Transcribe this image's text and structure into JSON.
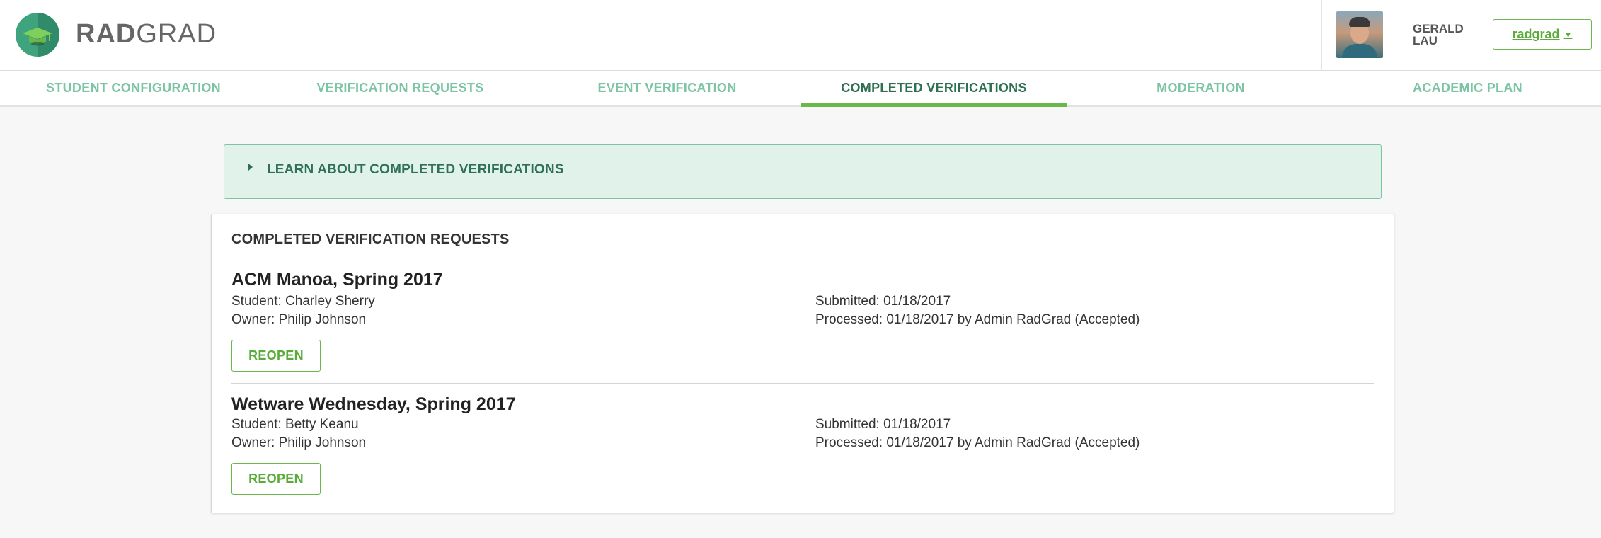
{
  "header": {
    "logo_bold": "RAD",
    "logo_rest": "GRAD",
    "user_name": "GERALD LAU",
    "account_label": "radgrad"
  },
  "tabs": [
    {
      "label": "STUDENT CONFIGURATION",
      "active": false
    },
    {
      "label": "VERIFICATION REQUESTS",
      "active": false
    },
    {
      "label": "EVENT VERIFICATION",
      "active": false
    },
    {
      "label": "COMPLETED VERIFICATIONS",
      "active": true
    },
    {
      "label": "MODERATION",
      "active": false
    },
    {
      "label": "ACADEMIC PLAN",
      "active": false
    }
  ],
  "info": {
    "label": "LEARN ABOUT COMPLETED VERIFICATIONS"
  },
  "completed": {
    "title": "COMPLETED VERIFICATION REQUESTS",
    "reopen_label": "REOPEN",
    "requests": [
      {
        "title": "ACM Manoa, Spring 2017",
        "student": "Student: Charley Sherry",
        "owner": "Owner: Philip Johnson",
        "submitted": "Submitted: 01/18/2017",
        "processed": "Processed: 01/18/2017 by Admin RadGrad (Accepted)"
      },
      {
        "title": "Wetware Wednesday, Spring 2017",
        "student": "Student: Betty Keanu",
        "owner": "Owner: Philip Johnson",
        "submitted": "Submitted: 01/18/2017",
        "processed": "Processed: 01/18/2017 by Admin RadGrad (Accepted)"
      }
    ]
  },
  "colors": {
    "brand_green": "#6ab84b",
    "tab_text": "#7cc4a4",
    "tab_active_text": "#2f6f52",
    "info_bg": "#e0f2ea"
  }
}
